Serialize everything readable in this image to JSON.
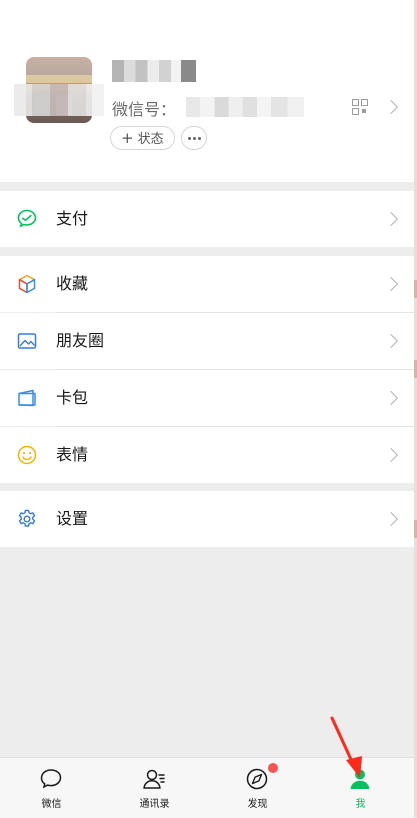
{
  "profile": {
    "wxid_label": "微信号：",
    "status_label": "状态",
    "status_plus": "+"
  },
  "menu": {
    "pay": "支付",
    "favorites": "收藏",
    "moments": "朋友圈",
    "cards": "卡包",
    "stickers": "表情",
    "settings": "设置"
  },
  "tabs": [
    {
      "label": "微信",
      "icon": "chat-bubble-icon"
    },
    {
      "label": "通讯录",
      "icon": "contacts-icon"
    },
    {
      "label": "发现",
      "icon": "compass-icon"
    },
    {
      "label": "我",
      "icon": "person-icon"
    }
  ],
  "colors": {
    "accent": "#07c160",
    "badge": "#fa5151",
    "annotation_arrow": "#ff2a1a"
  }
}
